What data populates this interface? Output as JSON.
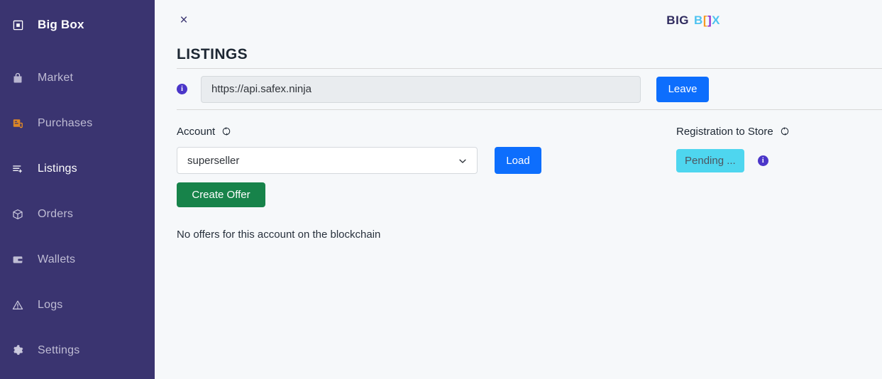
{
  "sidebar": {
    "brand": {
      "label": "Big Box",
      "icon": "app-square-icon"
    },
    "items": [
      {
        "label": "Market",
        "icon": "bag-icon",
        "accent": false,
        "active": false
      },
      {
        "label": "Purchases",
        "icon": "receipt-icon",
        "accent": true,
        "active": false
      },
      {
        "label": "Listings",
        "icon": "list-add-icon",
        "accent": false,
        "active": true
      },
      {
        "label": "Orders",
        "icon": "box-icon",
        "accent": false,
        "active": false
      },
      {
        "label": "Wallets",
        "icon": "wallet-icon",
        "accent": false,
        "active": false
      },
      {
        "label": "Logs",
        "icon": "warning-icon",
        "accent": false,
        "active": false
      },
      {
        "label": "Settings",
        "icon": "gear-icon",
        "accent": false,
        "active": false
      }
    ],
    "background_color": "#3a3470"
  },
  "topbar": {
    "close_label": "×",
    "logo": {
      "big": "BIG",
      "b": "B",
      "bracket_left": "[",
      "bracket_right": "]",
      "x": "X",
      "colors": {
        "big": "#2f2b5e",
        "b": "#4ec3f0",
        "bracket_left": "#f59a23",
        "bracket_right": "#8f28c9",
        "x": "#4ec3f0"
      }
    }
  },
  "page": {
    "title": "LISTINGS"
  },
  "url_row": {
    "info_icon": "info-icon",
    "input_value": "https://api.safex.ninja",
    "input_placeholder": "https://api.safex.ninja",
    "leave_label": "Leave",
    "leave_color": "#0d6efd"
  },
  "account": {
    "label": "Account",
    "refresh_icon": "refresh-icon",
    "selected": "superseller",
    "options": [
      "superseller"
    ],
    "load_label": "Load",
    "load_color": "#0d6efd",
    "create_offer_label": "Create Offer",
    "create_offer_color": "#17834a"
  },
  "offers": {
    "empty_message": "No offers for this account on the blockchain"
  },
  "registration": {
    "label": "Registration to Store",
    "refresh_icon": "refresh-icon",
    "status": "Pending ...",
    "status_color": "#4ed6ef",
    "info_icon": "info-icon"
  }
}
